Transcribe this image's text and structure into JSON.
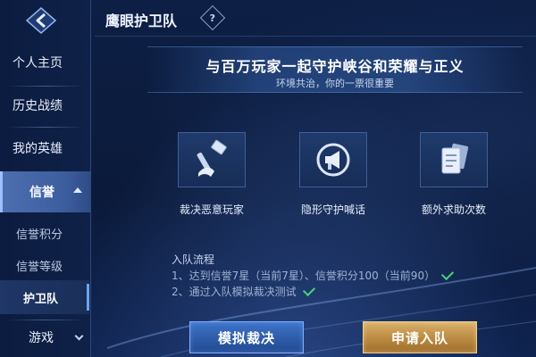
{
  "header": {
    "title": "鹰眼护卫队",
    "help_symbol": "?"
  },
  "sidebar": {
    "items": [
      {
        "label": "个人主页"
      },
      {
        "label": "历史战绩"
      },
      {
        "label": "我的英雄"
      }
    ],
    "active": {
      "label": "信誉"
    },
    "sub_items": [
      {
        "label": "信誉积分"
      },
      {
        "label": "信誉等级"
      }
    ],
    "sub_selected": {
      "label": "护卫队"
    },
    "game": {
      "label": "游戏"
    }
  },
  "banner": {
    "title": "与百万玩家一起守护峡谷和荣耀与正义",
    "subtitle": "环境共治，你的一票很重要"
  },
  "features": [
    {
      "label": "裁决恶意玩家",
      "icon": "hammer-icon"
    },
    {
      "label": "隐形守护喊话",
      "icon": "megaphone-icon"
    },
    {
      "label": "额外求助次数",
      "icon": "help-cards-icon"
    }
  ],
  "process": {
    "title": "入队流程",
    "steps": [
      {
        "text": "1、达到信誉7星（当前7星）、信誉积分100（当前90）",
        "done": true
      },
      {
        "text": "2、通过入队模拟裁决测试",
        "done": true
      }
    ]
  },
  "buttons": {
    "simulate": "模拟裁决",
    "apply": "申请入队"
  },
  "colors": {
    "background": "#0b1a3a",
    "active_tab": "#4d6fb0",
    "primary_button": "#3f74c9",
    "gold_button": "#d9b06a",
    "check_green": "#49d17a"
  }
}
